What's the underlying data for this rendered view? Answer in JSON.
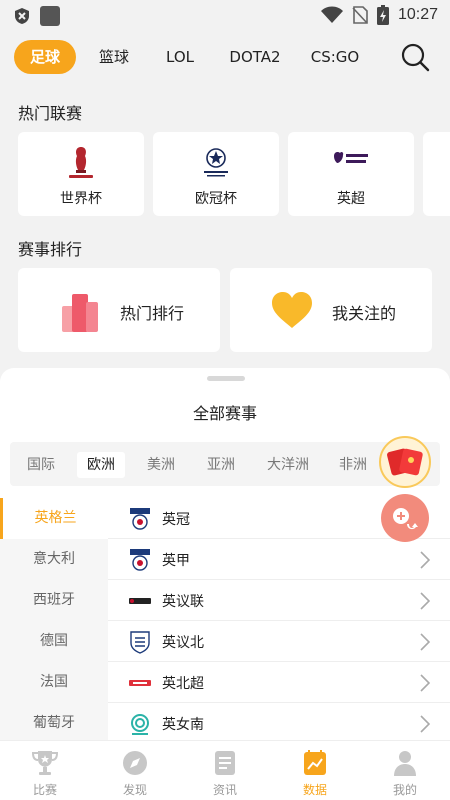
{
  "status_bar": {
    "time": "10:27"
  },
  "sports_tabs": [
    {
      "label": "足球",
      "active": true
    },
    {
      "label": "篮球",
      "active": false
    },
    {
      "label": "LOL",
      "active": false
    },
    {
      "label": "DOTA2",
      "active": false
    },
    {
      "label": "CS:GO",
      "active": false
    }
  ],
  "hot_leagues": {
    "title": "热门联赛",
    "items": [
      {
        "name": "世界杯",
        "icon": "world-cup-logo"
      },
      {
        "name": "欧冠杯",
        "icon": "champions-league-logo"
      },
      {
        "name": "英超",
        "icon": "premier-league-logo"
      }
    ]
  },
  "rankings": {
    "title": "赛事排行",
    "items": [
      {
        "label": "热门排行",
        "icon": "bar-chart-icon"
      },
      {
        "label": "我关注的",
        "icon": "heart-icon"
      }
    ]
  },
  "sheet": {
    "title": "全部赛事",
    "regions": [
      "国际",
      "欧洲",
      "美洲",
      "亚洲",
      "大洋洲",
      "非洲"
    ],
    "active_region": "欧洲",
    "countries": [
      "英格兰",
      "意大利",
      "西班牙",
      "德国",
      "法国",
      "葡萄牙"
    ],
    "active_country": "英格兰",
    "leagues": [
      {
        "name": "英冠",
        "icon": "efl-logo"
      },
      {
        "name": "英甲",
        "icon": "efl-logo"
      },
      {
        "name": "英议联",
        "icon": "national-league-logo"
      },
      {
        "name": "英议北",
        "icon": "fa-logo"
      },
      {
        "name": "英北超",
        "icon": "northern-premier-logo"
      },
      {
        "name": "英女南",
        "icon": "womens-league-logo"
      }
    ]
  },
  "bottom_nav": [
    {
      "label": "比赛",
      "icon": "trophy-icon",
      "active": false
    },
    {
      "label": "发现",
      "icon": "compass-icon",
      "active": false
    },
    {
      "label": "资讯",
      "icon": "news-icon",
      "active": false
    },
    {
      "label": "数据",
      "icon": "data-chart-icon",
      "active": true
    },
    {
      "label": "我的",
      "icon": "profile-icon",
      "active": false
    }
  ],
  "colors": {
    "accent": "#f7a51c",
    "background": "#f2f2f2"
  }
}
